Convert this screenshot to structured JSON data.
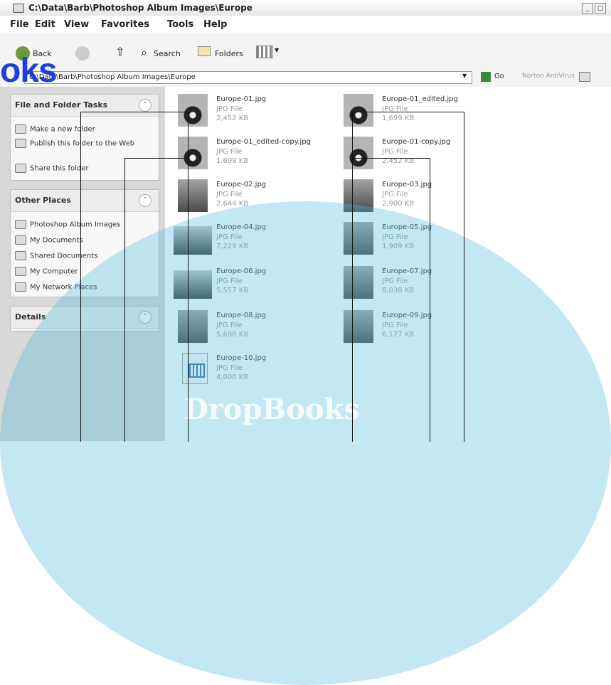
{
  "window": {
    "title": "C:\\Data\\Barb\\Photoshop Album Images\\Europe"
  },
  "menu": [
    "File",
    "Edit",
    "View",
    "Favorites",
    "Tools",
    "Help"
  ],
  "toolbar": {
    "back": "Back",
    "search": "Search",
    "folders": "Folders"
  },
  "address": {
    "path": "C:\\Data\\Barb\\Photoshop Album Images\\Europe",
    "go": "Go",
    "norton": "Norton AntiVirus"
  },
  "tasks": {
    "title": "File and Folder Tasks",
    "items": [
      "Make a new folder",
      "Publish this folder to the Web",
      "Share this folder"
    ]
  },
  "places": {
    "title": "Other Places",
    "items": [
      "Photoshop Album Images",
      "My Documents",
      "Shared Documents",
      "My Computer",
      "My Network Places"
    ]
  },
  "details": {
    "title": "Details"
  },
  "files": [
    {
      "name": "Europe-01.jpg",
      "type": "JPG File",
      "size": "2,452 KB"
    },
    {
      "name": "Europe-01_edited.jpg",
      "type": "JPG File",
      "size": "1,699 KB"
    },
    {
      "name": "Europe-01_edited-copy.jpg",
      "type": "JPG File",
      "size": "1,699 KB"
    },
    {
      "name": "Europe-01-copy.jpg",
      "type": "JPG File",
      "size": "2,452 KB"
    },
    {
      "name": "Europe-02.jpg",
      "type": "JPG File",
      "size": "2,644 KB"
    },
    {
      "name": "Europe-03.jpg",
      "type": "JPG File",
      "size": "2,900 KB"
    },
    {
      "name": "Europe-04.jpg",
      "type": "JPG File",
      "size": "7,229 KB"
    },
    {
      "name": "Europe-05.jpg",
      "type": "JPG File",
      "size": "1,909 KB"
    },
    {
      "name": "Europe-06.jpg",
      "type": "JPG File",
      "size": "5,557 KB"
    },
    {
      "name": "Europe-07.jpg",
      "type": "JPG File",
      "size": "8,038 KB"
    },
    {
      "name": "Europe-08.jpg",
      "type": "JPG File",
      "size": "5,698 KB"
    },
    {
      "name": "Europe-09.jpg",
      "type": "JPG File",
      "size": "6,177 KB"
    },
    {
      "name": "Europe-10.jpg",
      "type": "JPG File",
      "size": "4,000 KB"
    }
  ],
  "watermark": {
    "text": "oks",
    "logo": "DropBooks"
  }
}
